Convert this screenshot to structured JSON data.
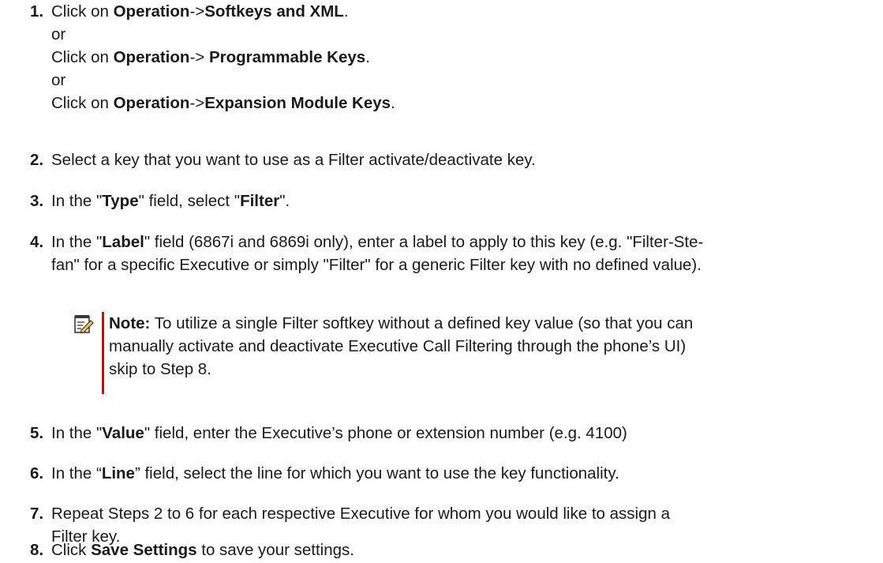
{
  "steps": [
    {
      "num": "1.",
      "lines": [
        [
          {
            "t": "Click on ",
            "b": false
          },
          {
            "t": "Operation",
            "b": true
          },
          {
            "t": "->",
            "b": false
          },
          {
            "t": "Softkeys and XML",
            "b": true
          },
          {
            "t": ".",
            "b": false
          }
        ],
        [
          {
            "t": "or",
            "b": false
          }
        ],
        [
          {
            "t": "Click on ",
            "b": false
          },
          {
            "t": "Operation",
            "b": true
          },
          {
            "t": "-> ",
            "b": false
          },
          {
            "t": "Programmable Keys",
            "b": true
          },
          {
            "t": ".",
            "b": false
          }
        ],
        [
          {
            "t": "or",
            "b": false
          }
        ],
        [
          {
            "t": "Click on ",
            "b": false
          },
          {
            "t": "Operation",
            "b": true
          },
          {
            "t": "->",
            "b": false
          },
          {
            "t": "Expansion Module Keys",
            "b": true
          },
          {
            "t": ".",
            "b": false
          }
        ]
      ]
    },
    {
      "num": "2.",
      "lines": [
        [
          {
            "t": "Select a key that you want to use as a Filter activate/deactivate key.",
            "b": false
          }
        ]
      ]
    },
    {
      "num": "3.",
      "lines": [
        [
          {
            "t": "In the \"",
            "b": false
          },
          {
            "t": "Type",
            "b": true
          },
          {
            "t": "\" field, select \"",
            "b": false
          },
          {
            "t": "Filter",
            "b": true
          },
          {
            "t": "\".",
            "b": false
          }
        ]
      ]
    },
    {
      "num": "4.",
      "lines": [
        [
          {
            "t": "In the \"",
            "b": false
          },
          {
            "t": "Label",
            "b": true
          },
          {
            "t": "\" field (6867i and 6869i only), enter a label to apply to this key (e.g. \"Filter-Ste-",
            "b": false
          }
        ],
        [
          {
            "t": "fan\" for a specific Executive or simply \"Filter\" for a generic Filter key with no defined value).",
            "b": false
          }
        ]
      ]
    },
    {
      "num": "5.",
      "lines": [
        [
          {
            "t": "In the \"",
            "b": false
          },
          {
            "t": "Value",
            "b": true
          },
          {
            "t": "\" field, enter the Executive’s phone or extension number (e.g. 4100)",
            "b": false
          }
        ]
      ]
    },
    {
      "num": "6.",
      "lines": [
        [
          {
            "t": "In the “",
            "b": false
          },
          {
            "t": "Line",
            "b": true
          },
          {
            "t": "” field, select the line for which you want to use the key functionality.",
            "b": false
          }
        ]
      ]
    },
    {
      "num": "7.",
      "lines": [
        [
          {
            "t": "Repeat Steps 2 to 6 for each respective Executive for whom you would like to assign a",
            "b": false
          }
        ],
        [
          {
            "t": "Filter key.",
            "b": false
          }
        ]
      ]
    },
    {
      "num": "8.",
      "lines": [
        [
          {
            "t": "Click ",
            "b": false
          },
          {
            "t": "Save Settings",
            "b": true
          },
          {
            "t": " to save your settings.",
            "b": false
          }
        ]
      ]
    }
  ],
  "note": {
    "icon": "note-pencil-icon",
    "lines": [
      [
        {
          "t": "Note:",
          "b": true
        },
        {
          "t": " To utilize a single Filter softkey without a defined key value (so that you can",
          "b": false
        }
      ],
      [
        {
          "t": "manually activate and deactivate Executive Call Filtering through the phone’s UI)",
          "b": false
        }
      ],
      [
        {
          "t": "skip to Step 8.",
          "b": false
        }
      ]
    ]
  },
  "colors": {
    "note_bar": "#d0021b",
    "text": "#1a1a1a"
  }
}
